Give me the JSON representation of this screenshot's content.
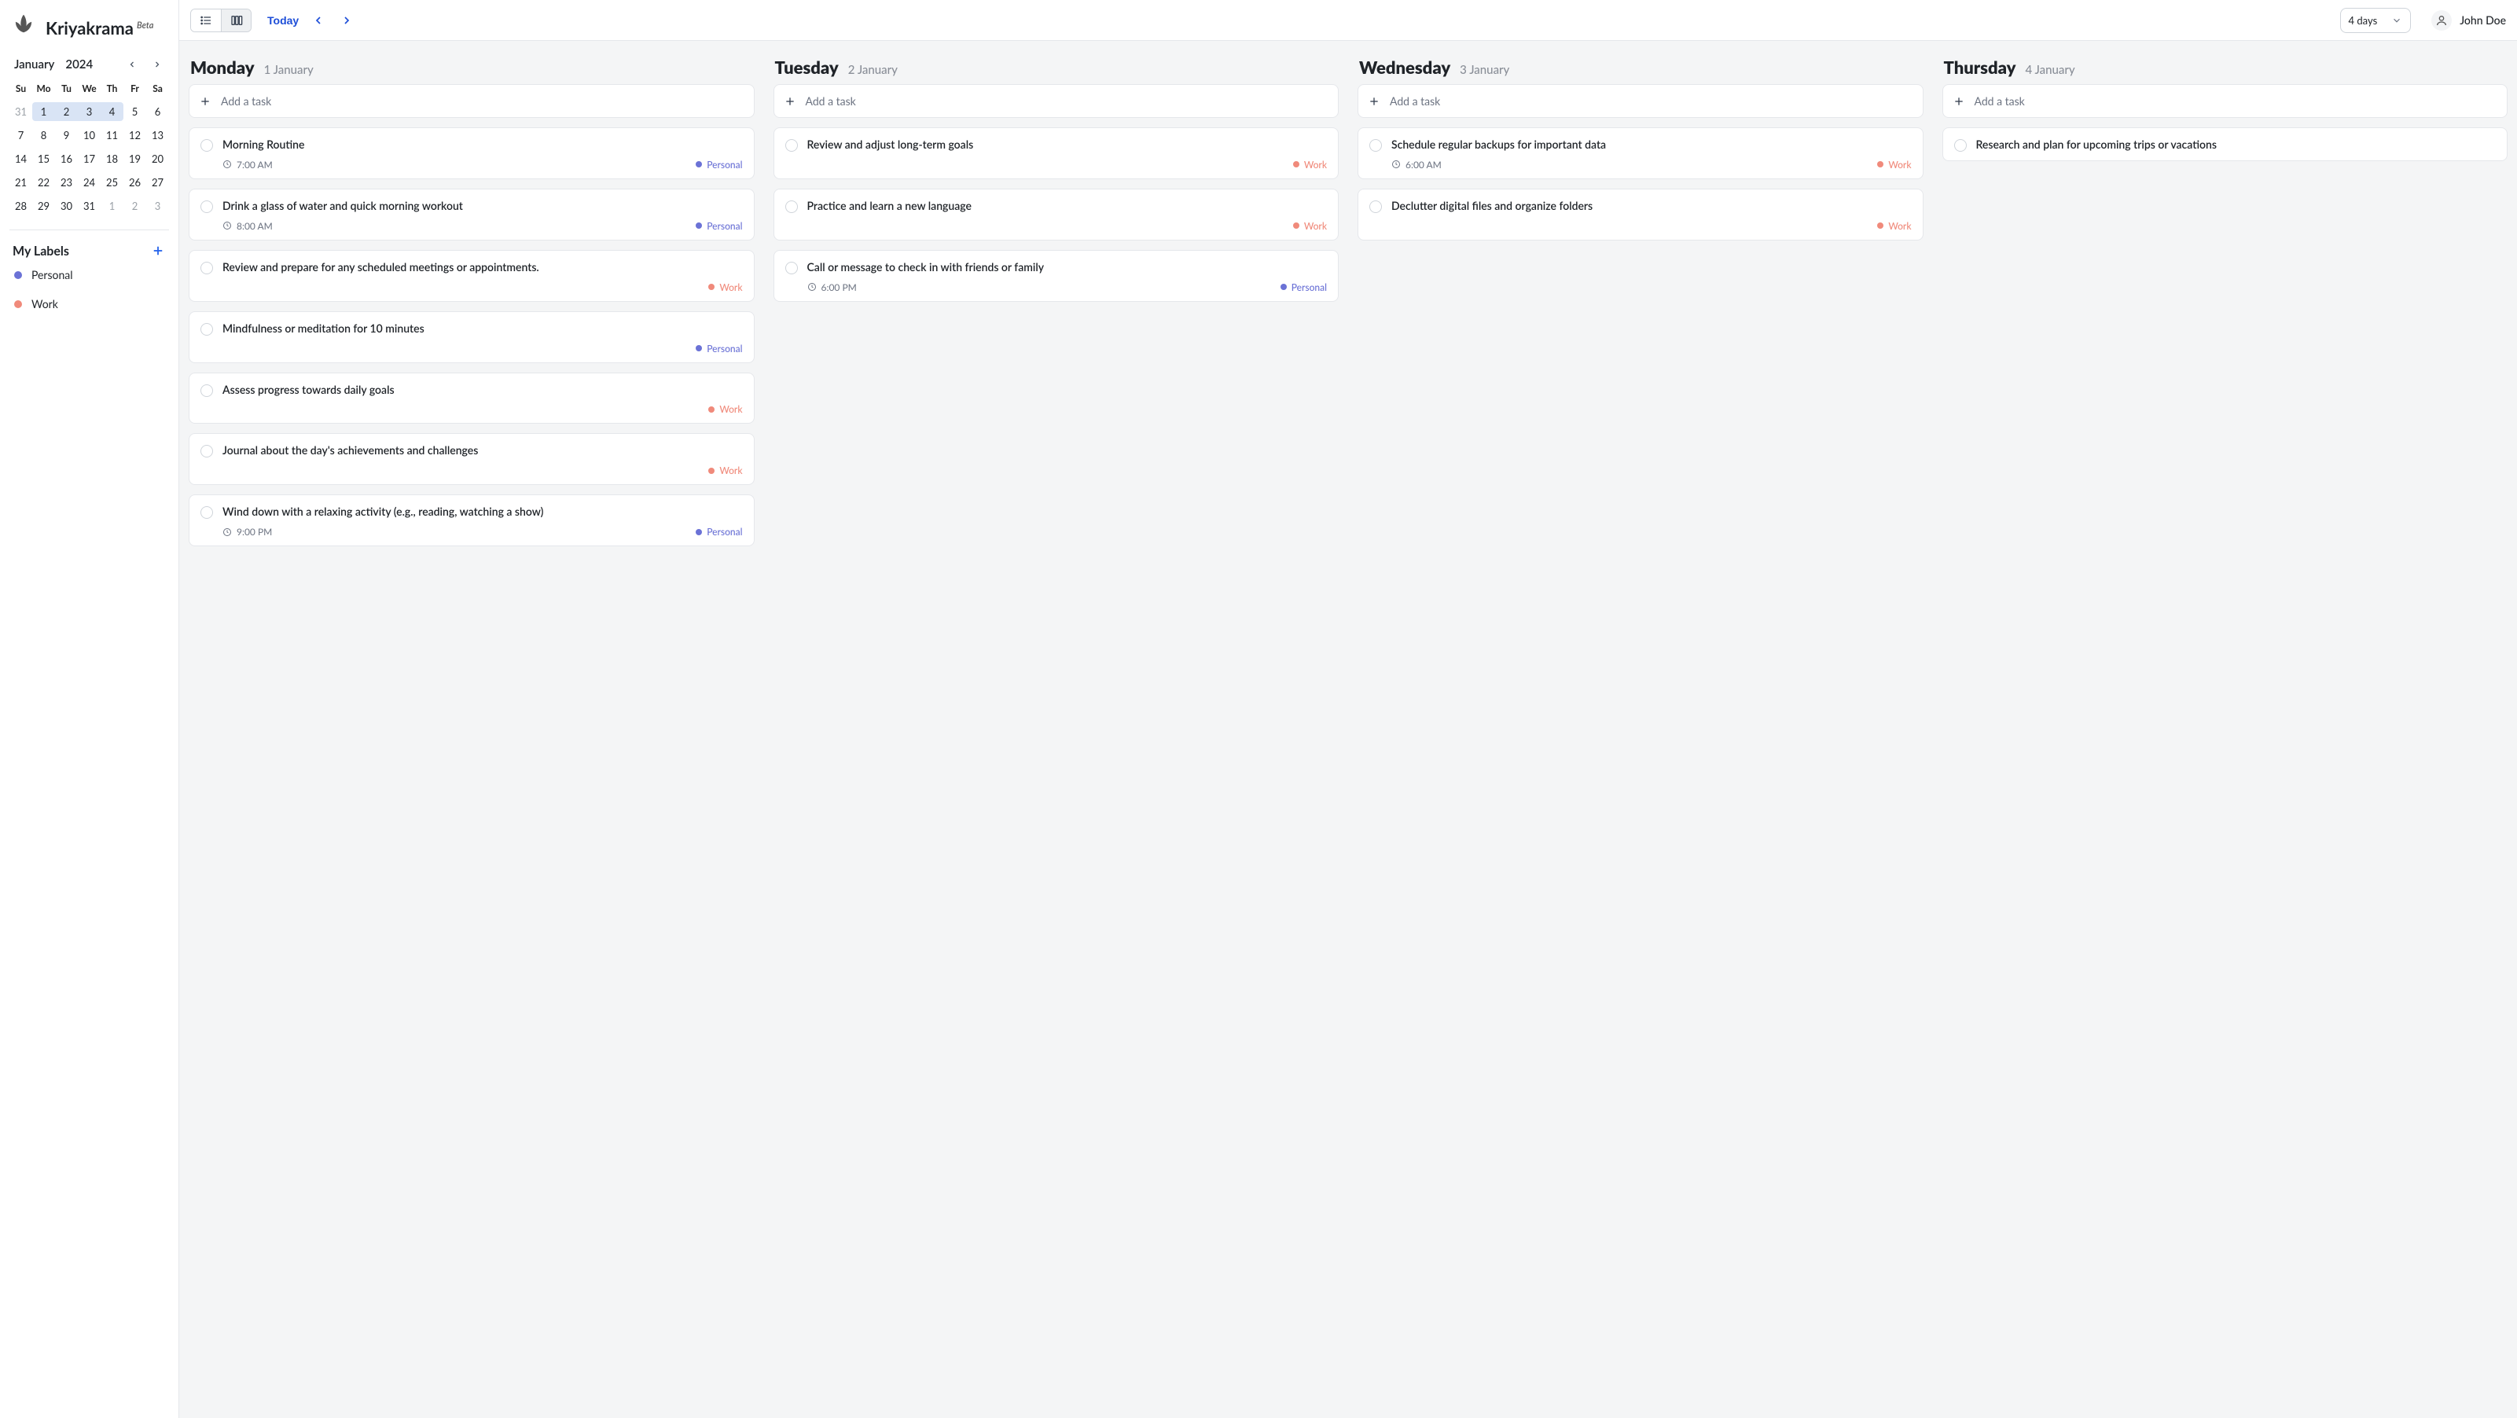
{
  "brand": {
    "name": "Kriyakrama",
    "badge": "Beta"
  },
  "colors": {
    "personal": "#6b72d6",
    "work": "#f08a7b",
    "accent": "#1d4ed8"
  },
  "sidebar": {
    "cal": {
      "month": "January",
      "year": "2024",
      "dow": [
        "Su",
        "Mo",
        "Tu",
        "We",
        "Th",
        "Fr",
        "Sa"
      ],
      "days": [
        {
          "n": "31",
          "muted": true
        },
        {
          "n": "1",
          "hl": true,
          "first": true
        },
        {
          "n": "2",
          "hl": true
        },
        {
          "n": "3",
          "hl": true
        },
        {
          "n": "4",
          "hl": true,
          "last": true
        },
        {
          "n": "5"
        },
        {
          "n": "6"
        },
        {
          "n": "7"
        },
        {
          "n": "8"
        },
        {
          "n": "9"
        },
        {
          "n": "10"
        },
        {
          "n": "11"
        },
        {
          "n": "12"
        },
        {
          "n": "13"
        },
        {
          "n": "14"
        },
        {
          "n": "15"
        },
        {
          "n": "16"
        },
        {
          "n": "17"
        },
        {
          "n": "18"
        },
        {
          "n": "19"
        },
        {
          "n": "20"
        },
        {
          "n": "21"
        },
        {
          "n": "22"
        },
        {
          "n": "23"
        },
        {
          "n": "24"
        },
        {
          "n": "25"
        },
        {
          "n": "26"
        },
        {
          "n": "27"
        },
        {
          "n": "28"
        },
        {
          "n": "29"
        },
        {
          "n": "30"
        },
        {
          "n": "31"
        },
        {
          "n": "1",
          "muted": true
        },
        {
          "n": "2",
          "muted": true
        },
        {
          "n": "3",
          "muted": true
        }
      ]
    },
    "labels_title": "My Labels",
    "labels": [
      {
        "name": "Personal",
        "colorKey": "personal"
      },
      {
        "name": "Work",
        "colorKey": "work"
      }
    ]
  },
  "topbar": {
    "today": "Today",
    "range": "4 days",
    "user": "John Doe"
  },
  "board": {
    "add_placeholder": "Add a task",
    "columns": [
      {
        "name": "Monday",
        "date": "1 January",
        "tasks": [
          {
            "title": "Morning Routine",
            "time": "7:00 AM",
            "label": "Personal"
          },
          {
            "title": "Drink a glass of water and quick morning workout",
            "time": "8:00 AM",
            "label": "Personal"
          },
          {
            "title": "Review and prepare for any scheduled meetings or appointments.",
            "label": "Work"
          },
          {
            "title": "Mindfulness or meditation for 10 minutes",
            "label": "Personal"
          },
          {
            "title": "Assess progress towards daily goals",
            "label": "Work"
          },
          {
            "title": "Journal about the day's achievements and challenges",
            "label": "Work"
          },
          {
            "title": "Wind down with a relaxing activity (e.g., reading, watching a show)",
            "time": "9:00 PM",
            "label": "Personal"
          }
        ]
      },
      {
        "name": "Tuesday",
        "date": "2 January",
        "tasks": [
          {
            "title": "Review and adjust long-term goals",
            "label": "Work"
          },
          {
            "title": "Practice and learn a new language",
            "label": "Work"
          },
          {
            "title": "Call or message to check in with friends or family",
            "time": "6:00 PM",
            "label": "Personal"
          }
        ]
      },
      {
        "name": "Wednesday",
        "date": "3 January",
        "tasks": [
          {
            "title": "Schedule regular backups for important data",
            "time": "6:00 AM",
            "label": "Work"
          },
          {
            "title": "Declutter digital files and organize folders",
            "label": "Work"
          }
        ]
      },
      {
        "name": "Thursday",
        "date": "4 January",
        "tasks": [
          {
            "title": "Research and plan for upcoming trips or vacations"
          }
        ]
      }
    ]
  }
}
